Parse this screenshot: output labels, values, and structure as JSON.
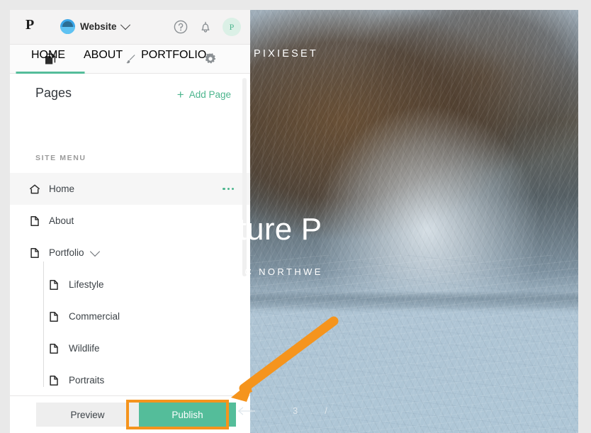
{
  "app": {
    "brand_initial": "P",
    "site_name": "Website",
    "site_icon": "pixieset-logo-icon",
    "caret_icon": "chevron-down-icon",
    "help_icon": "help-circle-icon",
    "notifications_icon": "bell-icon",
    "avatar_initial": "P"
  },
  "tabs": [
    {
      "name": "pages",
      "icon": "pages-icon",
      "active": true
    },
    {
      "name": "design",
      "icon": "brush-icon",
      "active": false
    },
    {
      "name": "settings",
      "icon": "gear-icon",
      "active": false
    }
  ],
  "pages_panel": {
    "title": "Pages",
    "add_page_label": "Add Page",
    "add_page_icon": "plus-icon",
    "section_label": "SITE MENU",
    "items": [
      {
        "label": "Home",
        "icon": "home-icon",
        "level": 1,
        "selected": true,
        "has_menu": true,
        "expandable": false
      },
      {
        "label": "About",
        "icon": "page-icon",
        "level": 1,
        "selected": false,
        "has_menu": false,
        "expandable": false
      },
      {
        "label": "Portfolio",
        "icon": "page-icon",
        "level": 1,
        "selected": false,
        "has_menu": false,
        "expandable": true
      },
      {
        "label": "Lifestyle",
        "icon": "page-icon",
        "level": 2,
        "selected": false,
        "has_menu": false,
        "expandable": false
      },
      {
        "label": "Commercial",
        "icon": "page-icon",
        "level": 2,
        "selected": false,
        "has_menu": false,
        "expandable": false
      },
      {
        "label": "Wildlife",
        "icon": "page-icon",
        "level": 2,
        "selected": false,
        "has_menu": false,
        "expandable": false
      },
      {
        "label": "Portraits",
        "icon": "page-icon",
        "level": 2,
        "selected": false,
        "has_menu": false,
        "expandable": false
      }
    ]
  },
  "footer": {
    "preview_label": "Preview",
    "publish_label": "Publish"
  },
  "site_preview": {
    "nav_links": [
      "HOME",
      "ABOUT",
      "PORTFOLIO"
    ],
    "brand": "PIXIESET",
    "hero_title": "Adventure P",
    "hero_subtitle": "PACIFIC NORTHWE",
    "slide_prev_icon": "arrow-left-icon",
    "slide_current": "3",
    "slide_separator": "/"
  },
  "annotation": {
    "arrow_icon": "arrow-pointer-icon",
    "arrow_color": "#f5941d",
    "highlight_target": "Publish"
  },
  "colors": {
    "accent_green": "#4cb58d",
    "publish_green": "#54bd9a",
    "annotation_orange": "#f5941d",
    "panel_bg": "#ffffff",
    "topbar_bg": "#f4f3f3",
    "page_bg": "#e9e9e9"
  }
}
